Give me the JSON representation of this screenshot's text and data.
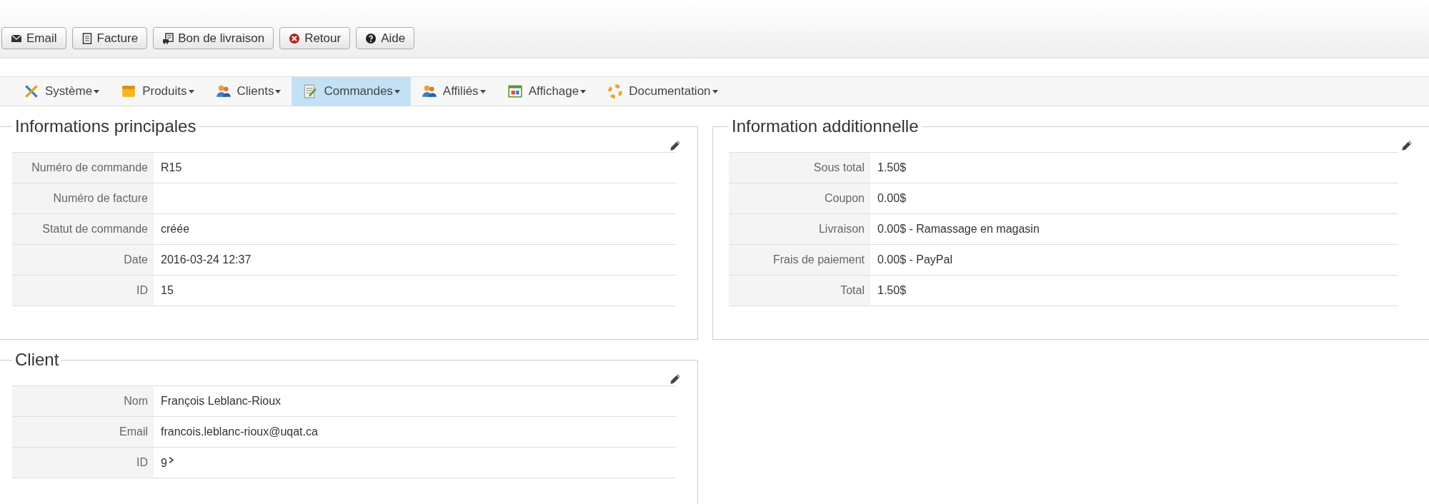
{
  "toolbar": {
    "buttons": [
      {
        "label": "Email",
        "kind": "email"
      },
      {
        "label": "Facture",
        "kind": "invoice"
      },
      {
        "label": "Bon de livraison",
        "kind": "delivery"
      },
      {
        "label": "Retour",
        "kind": "back"
      },
      {
        "label": "Aide",
        "kind": "help"
      }
    ]
  },
  "menu": {
    "items": [
      {
        "label": "Système",
        "kind": "system",
        "selected": false
      },
      {
        "label": "Produits",
        "kind": "products",
        "selected": false
      },
      {
        "label": "Clients",
        "kind": "clients",
        "selected": false
      },
      {
        "label": "Commandes",
        "kind": "orders",
        "selected": true
      },
      {
        "label": "Affiliés",
        "kind": "affiliates",
        "selected": false
      },
      {
        "label": "Affichage",
        "kind": "display",
        "selected": false
      },
      {
        "label": "Documentation",
        "kind": "docs",
        "selected": false
      }
    ]
  },
  "panels": [
    {
      "title": "Informations principales",
      "rows": [
        {
          "label": "Numéro de commande",
          "value": "R15",
          "linked": false
        },
        {
          "label": "Numéro de facture",
          "value": "",
          "linked": false
        },
        {
          "label": "Statut de commande",
          "value": "créée",
          "linked": false
        },
        {
          "label": "Date",
          "value": "2016-03-24 12:37",
          "linked": false
        },
        {
          "label": "ID",
          "value": "15",
          "linked": false
        }
      ]
    },
    {
      "title": "Information additionnelle",
      "rows": [
        {
          "label": "Sous total",
          "value": "1.50$",
          "linked": false
        },
        {
          "label": "Coupon",
          "value": "0.00$",
          "linked": false
        },
        {
          "label": "Livraison",
          "value": "0.00$ - Ramassage en magasin",
          "linked": false
        },
        {
          "label": "Frais de paiement",
          "value": "0.00$ - PayPal",
          "linked": false
        },
        {
          "label": "Total",
          "value": "1.50$",
          "linked": false
        }
      ]
    },
    {
      "title": "Client",
      "rows": [
        {
          "label": "Nom",
          "value": "François Leblanc-Rioux",
          "linked": false
        },
        {
          "label": "Email",
          "value": "francois.leblanc-rioux@uqat.ca",
          "linked": false
        },
        {
          "label": "ID",
          "value": "9",
          "linked": true
        }
      ]
    }
  ]
}
